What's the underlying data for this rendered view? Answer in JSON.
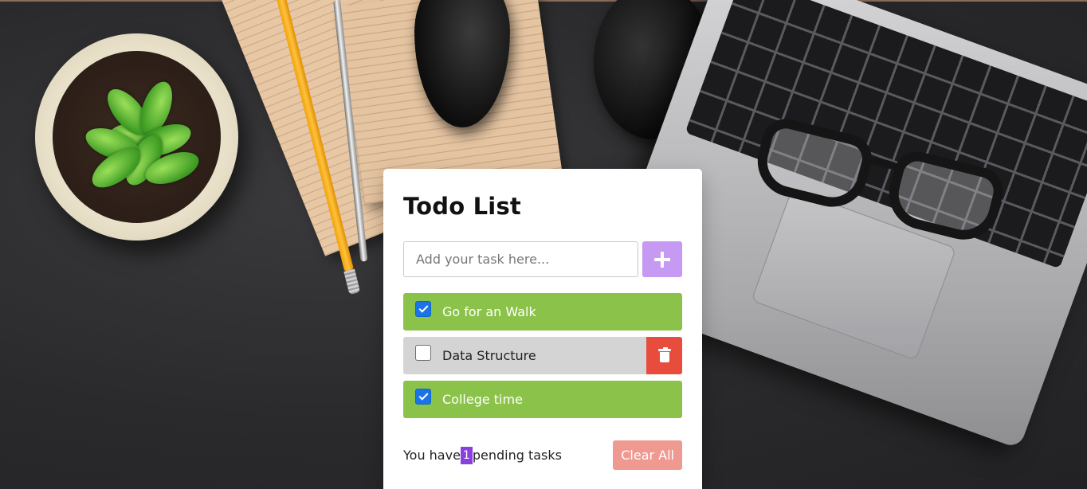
{
  "app": {
    "title": "Todo List"
  },
  "input": {
    "value": "",
    "placeholder": "Add your task here..."
  },
  "add_button": {
    "icon": "plus-icon"
  },
  "tasks": [
    {
      "label": "Go for an Walk",
      "completed": true
    },
    {
      "label": "Data Structure",
      "completed": false
    },
    {
      "label": "College time",
      "completed": true
    }
  ],
  "footer": {
    "prefix": "You have",
    "count": "1",
    "suffix": "pending tasks",
    "clear_label": "Clear All"
  },
  "colors": {
    "add_button": "#c69af2",
    "task_done": "#8bc34a",
    "task_pending": "#d4d4d4",
    "delete_button": "#e74c3c",
    "pending_badge": "#8a3fe0",
    "clear_button": "#f09990"
  }
}
